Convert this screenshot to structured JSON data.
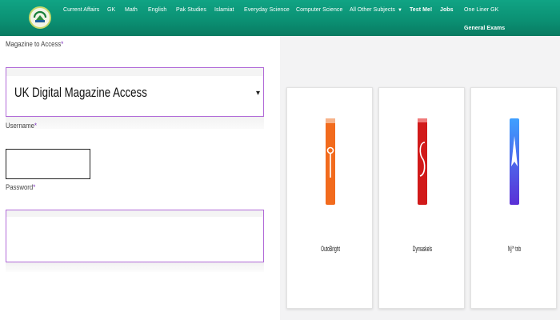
{
  "nav": {
    "links": [
      "Current Affairs",
      "GK",
      "Math",
      "English",
      "Pak Studies",
      "Islamiat",
      "Everyday Science",
      "Computer Science",
      "All Other Subjects",
      "Test Me!",
      "Jobs",
      "One Liner GK",
      "General Exams"
    ],
    "colors": {
      "navbar": "#0b8f72",
      "text": "#ffffff"
    }
  },
  "form": {
    "magazine_label": "Magazine to Access",
    "required_mark": "*",
    "magazine_value": "UK Digital Magazine Access",
    "username_label": "Username",
    "password_label": "Password",
    "accent_color": "#b16ad8"
  },
  "cards": [
    {
      "label": "OutoBright",
      "icon": "orange-app-icon",
      "color": "#f26b1d"
    },
    {
      "label": "Dymaskels",
      "icon": "red-app-icon",
      "color": "#d11a1a"
    },
    {
      "label": "Nj'^ tnb",
      "icon": "blue-arrow-app-icon",
      "color": "#3a4ee8"
    }
  ]
}
